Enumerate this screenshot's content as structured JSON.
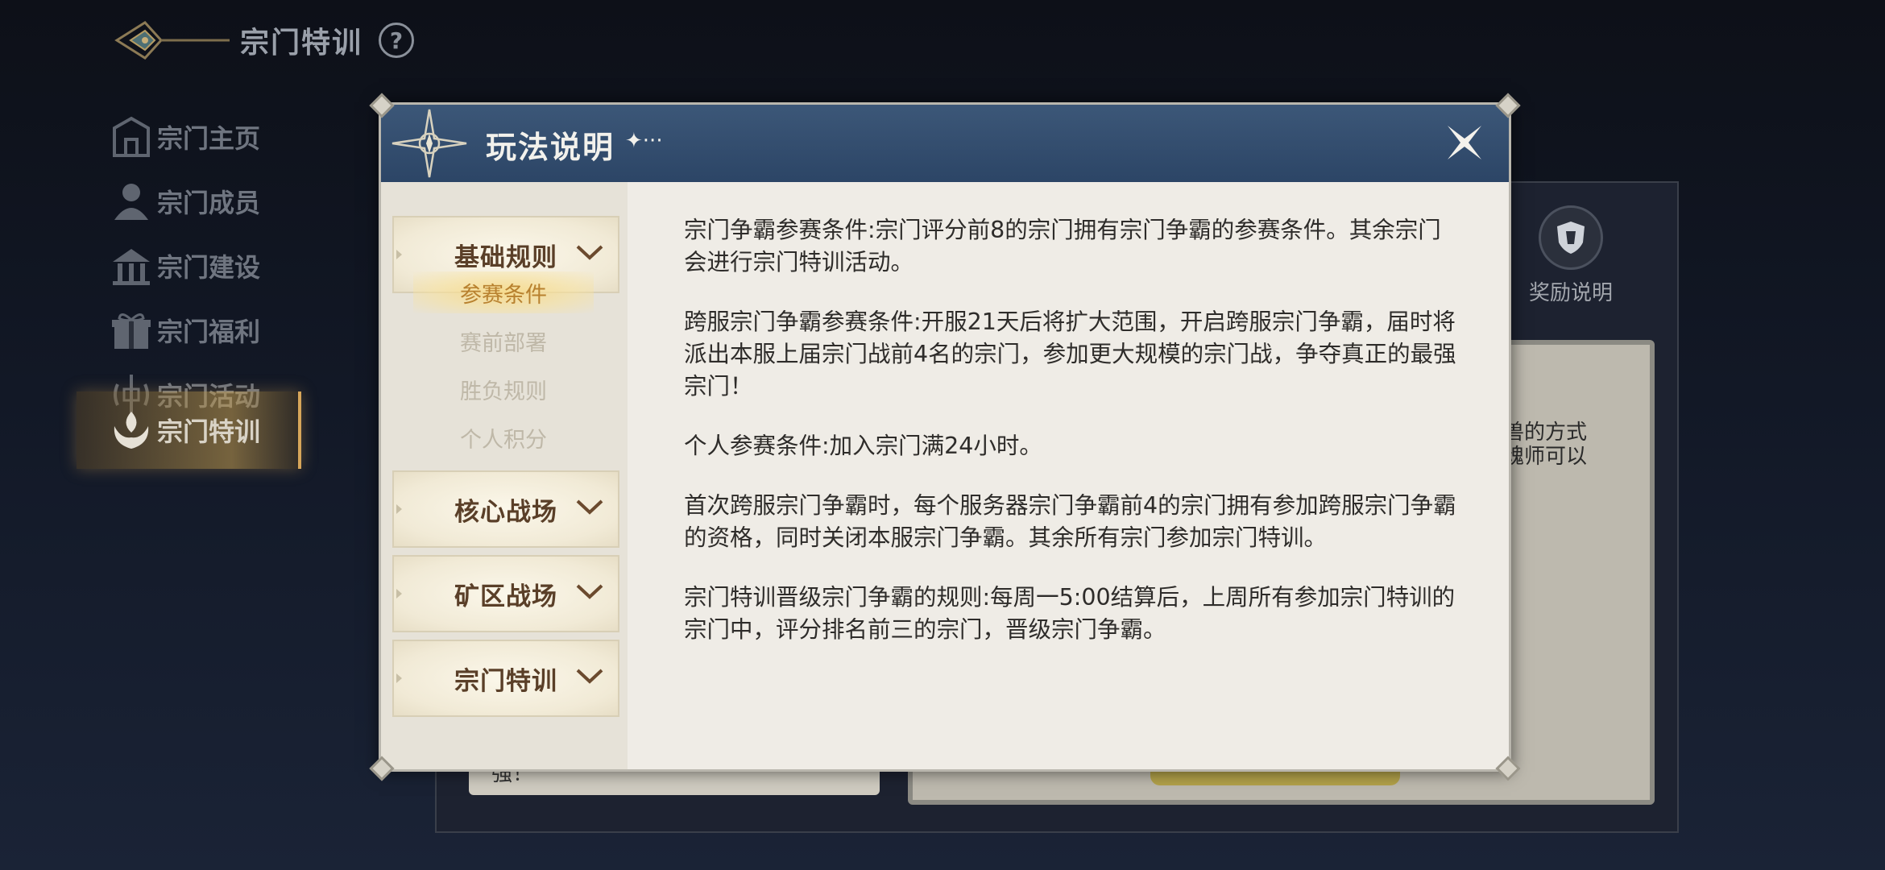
{
  "header": {
    "title": "宗门特训",
    "help_symbol": "?"
  },
  "nav": [
    {
      "label": "宗门主页",
      "icon": "sect-home-icon",
      "active": false
    },
    {
      "label": "宗门成员",
      "icon": "members-icon",
      "active": false
    },
    {
      "label": "宗门建设",
      "icon": "construction-icon",
      "active": false
    },
    {
      "label": "宗门福利",
      "icon": "gift-icon",
      "active": false
    },
    {
      "label": "宗门活动",
      "icon": "activity-icon",
      "active": false
    },
    {
      "label": "宗门特训",
      "icon": "training-icon",
      "active": true
    }
  ],
  "background": {
    "reward_label": "奖励说明",
    "partial_text_line1": "兽的方式",
    "partial_text_line2": "魂师可以",
    "bottom_text": "强！"
  },
  "modal": {
    "title": "玩法说明",
    "title_deco": "✦···",
    "categories": [
      {
        "label": "基础规则",
        "expanded": true,
        "items": [
          {
            "label": "参赛条件",
            "active": true
          },
          {
            "label": "赛前部署",
            "active": false
          },
          {
            "label": "胜负规则",
            "active": false
          },
          {
            "label": "个人积分",
            "active": false
          }
        ]
      },
      {
        "label": "核心战场",
        "expanded": false
      },
      {
        "label": "矿区战场",
        "expanded": false
      },
      {
        "label": "宗门特训",
        "expanded": false
      }
    ],
    "paragraphs": [
      "宗门争霸参赛条件:宗门评分前8的宗门拥有宗门争霸的参赛条件。其余宗门会进行宗门特训活动。",
      "跨服宗门争霸参赛条件:开服21天后将扩大范围，开启跨服宗门争霸，届时将派出本服上届宗门战前4名的宗门，参加更大规模的宗门战，争夺真正的最强宗门！",
      "个人参赛条件:加入宗门满24小时。",
      "首次跨服宗门争霸时，每个服务器宗门争霸前4的宗门拥有参加跨服宗门争霸的资格，同时关闭本服宗门争霸。其余所有宗门参加宗门特训。",
      "宗门特训晋级宗门争霸的规则:每周一5:00结算后，上周所有参加宗门特训的宗门中，评分排名前三的宗门，晋级宗门争霸。"
    ]
  },
  "colors": {
    "accent_gold": "#d7a65a",
    "modal_header": "#34506f",
    "active_tab": "#b8812f"
  }
}
